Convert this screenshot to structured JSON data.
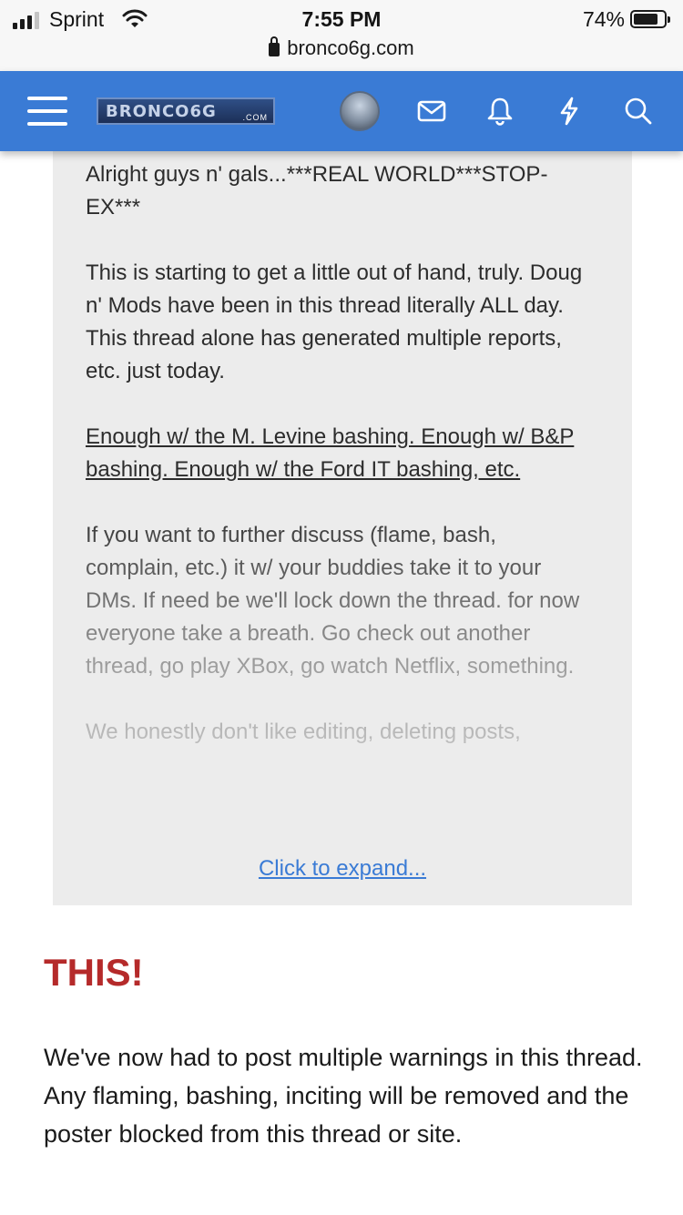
{
  "status_bar": {
    "carrier": "Sprint",
    "time": "7:55 PM",
    "battery": "74%",
    "battery_level": 0.74
  },
  "browser": {
    "url": "bronco6g.com"
  },
  "navbar": {
    "brand_color": "#3a7bd5",
    "logo_text": "BRONCO6G",
    "logo_sub": ".COM",
    "icons": [
      "menu-icon",
      "avatar",
      "envelope-icon",
      "bell-icon",
      "bolt-icon",
      "search-icon"
    ]
  },
  "quote": {
    "paragraphs": [
      "Alright guys n' gals...***REAL WORLD***STOP-EX***",
      "This is starting to get a little out of hand, truly. Doug n' Mods have been in this thread literally ALL day. This thread alone has generated multiple reports, etc. just today.",
      "Enough w/ the M. Levine bashing. Enough w/ B&P bashing. Enough w/ the Ford IT bashing, etc.",
      "If you want to further discuss (flame, bash, complain, etc.) it w/ your buddies take it to your DMs. If need be we'll lock down the thread. for now everyone take a breath. Go check out another thread, go play XBox, go watch Netflix, something.",
      "We honestly don't like editing, deleting posts,"
    ],
    "expand_label": "Click to expand..."
  },
  "post": {
    "heading": "THIS!",
    "heading_color": "#b52a2a",
    "body": "We've now had to post multiple warnings in this thread. Any flaming, bashing, inciting will be removed and the poster blocked from this thread or site."
  }
}
